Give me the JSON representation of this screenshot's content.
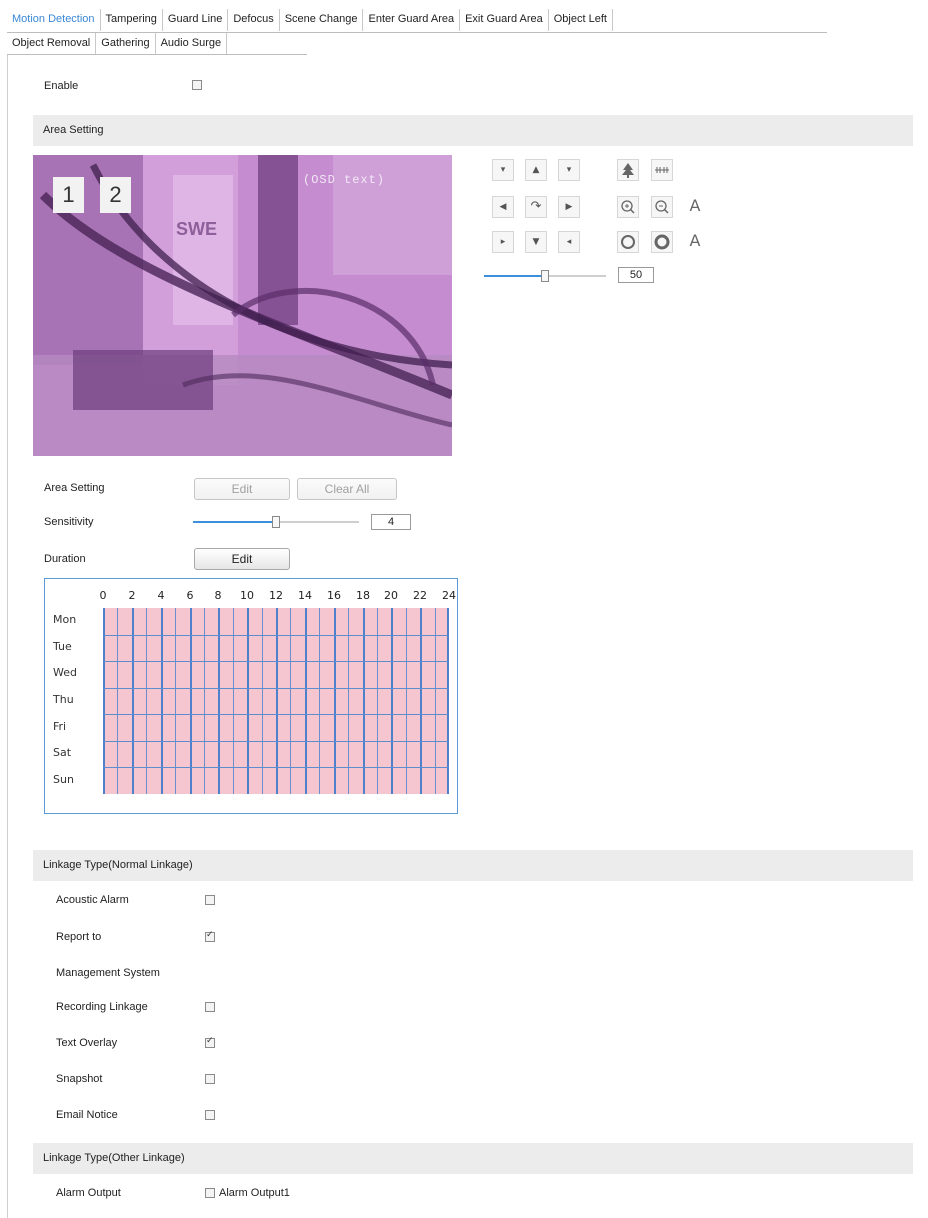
{
  "tabs": {
    "row1": [
      "Motion Detection",
      "Tampering",
      "Guard Line",
      "Defocus",
      "Scene Change",
      "Enter Guard Area",
      "Exit Guard Area",
      "Object Left"
    ],
    "row2": [
      "Object Removal",
      "Gathering",
      "Audio Surge"
    ],
    "active": "Motion Detection"
  },
  "enable": {
    "label": "Enable",
    "checked": false
  },
  "area_setting_header": "Area Setting",
  "video": {
    "region_labels": [
      "1",
      "2"
    ],
    "timestamp": "(OSD text)"
  },
  "ptz": {
    "direction_glyphs": [
      "▾",
      "▲",
      "▾",
      "◀",
      "↷",
      "▶",
      "▸",
      "▼",
      "◂"
    ],
    "function_icons": [
      "tree-icon",
      "focus-lines-icon",
      "zoom-in-icon",
      "zoom-out-icon",
      "iris-a-icon",
      "iris-open-icon",
      "iris-close-icon",
      "auto-a-icon"
    ],
    "speed_value": "50",
    "speed_fraction": 0.5
  },
  "area_setting": {
    "label": "Area Setting",
    "edit_label": "Edit",
    "clear_label": "Clear All"
  },
  "sensitivity": {
    "label": "Sensitivity",
    "value": "4",
    "fraction": 0.5
  },
  "duration": {
    "label": "Duration",
    "edit_label": "Edit"
  },
  "schedule": {
    "hours": [
      "0",
      "2",
      "4",
      "6",
      "8",
      "10",
      "12",
      "14",
      "16",
      "18",
      "20",
      "22",
      "24"
    ],
    "days": [
      "Mon",
      "Tue",
      "Wed",
      "Thu",
      "Fri",
      "Sat",
      "Sun"
    ],
    "fill_color": "#f5c6cf",
    "grid_color": "#4f80cc"
  },
  "linkage_normal": {
    "header": "Linkage Type(Normal Linkage)",
    "items": [
      {
        "label": "Acoustic Alarm",
        "checked": false
      },
      {
        "label": "Report to",
        "checked": true
      },
      {
        "label": "Management System",
        "checked": null
      },
      {
        "label": "Recording Linkage",
        "checked": false
      },
      {
        "label": "Text Overlay",
        "checked": true
      },
      {
        "label": "Snapshot",
        "checked": false
      },
      {
        "label": "Email Notice",
        "checked": false
      }
    ]
  },
  "linkage_other": {
    "header": "Linkage Type(Other Linkage)",
    "alarm_output_label": "Alarm Output",
    "alarm_output1_label": "Alarm Output1",
    "alarm_output1_checked": false
  }
}
